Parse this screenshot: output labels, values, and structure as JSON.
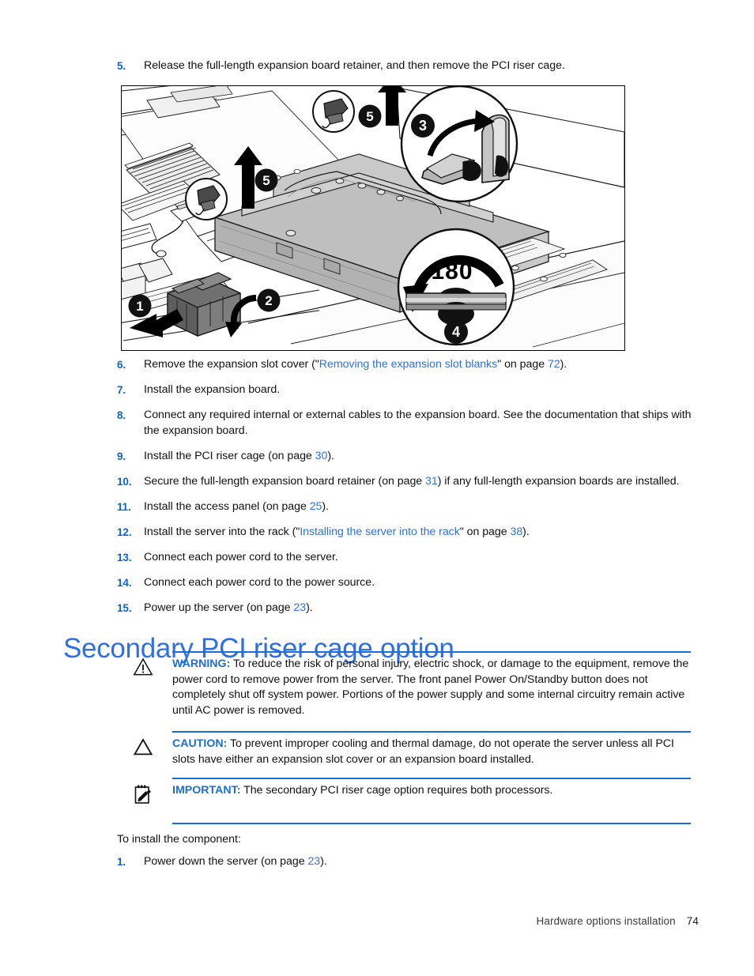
{
  "document": {
    "footer_title": "Hardware options installation",
    "page_number": "74"
  },
  "colors": {
    "link_blue": "#2f6fe4",
    "heading_blue": "#2f6fe4",
    "admonition_blue": "#1a6fd4",
    "number_blue": "#0b63d6"
  },
  "step5": {
    "number": "5.",
    "text": "Release the full-length expansion board retainer, and then remove the PCI riser cage."
  },
  "figure": {
    "caption": "",
    "callouts": [
      {
        "id": "1",
        "meaning": "press-retainer-release"
      },
      {
        "id": "2",
        "meaning": "rotate-retainer-open"
      },
      {
        "id": "3",
        "meaning": "lift-and-rotate-latch"
      },
      {
        "id": "4",
        "meaning": "rotate-180-degrees"
      },
      {
        "id": "5",
        "meaning": "lift-riser-cage-up"
      }
    ],
    "rotation_label": "180",
    "rotation_degree_symbol": "o"
  },
  "steps": [
    {
      "number": "6.",
      "parts": [
        {
          "t": "Remove the expansion slot cover (\"",
          "k": "plain"
        },
        {
          "t": "Removing the expansion slot blanks",
          "k": "link"
        },
        {
          "t": "\" on page ",
          "k": "plain"
        },
        {
          "t": "72",
          "k": "page"
        },
        {
          "t": ").",
          "k": "plain"
        }
      ]
    },
    {
      "number": "7.",
      "parts": [
        {
          "t": "Install the expansion board.",
          "k": "plain"
        }
      ]
    },
    {
      "number": "8.",
      "parts": [
        {
          "t": "Connect any required internal or external cables to the expansion board. See the documentation that ships with the expansion board.",
          "k": "plain"
        }
      ]
    },
    {
      "number": "9.",
      "parts": [
        {
          "t": "Install the PCI riser cage (on page ",
          "k": "plain"
        },
        {
          "t": "30",
          "k": "page"
        },
        {
          "t": ").",
          "k": "plain"
        }
      ]
    },
    {
      "number": "10.",
      "parts": [
        {
          "t": "Secure the full-length expansion board retainer (on page ",
          "k": "plain"
        },
        {
          "t": "31",
          "k": "page"
        },
        {
          "t": ") if any full-length expansion boards are installed.",
          "k": "plain"
        }
      ]
    },
    {
      "number": "11.",
      "parts": [
        {
          "t": "Install the access panel (on page ",
          "k": "plain"
        },
        {
          "t": "25",
          "k": "page"
        },
        {
          "t": ").",
          "k": "plain"
        }
      ]
    },
    {
      "number": "12.",
      "parts": [
        {
          "t": "Install the server into the rack (\"",
          "k": "plain"
        },
        {
          "t": "Installing the server into the rack",
          "k": "link"
        },
        {
          "t": "\" on page ",
          "k": "plain"
        },
        {
          "t": "38",
          "k": "page"
        },
        {
          "t": ").",
          "k": "plain"
        }
      ]
    },
    {
      "number": "13.",
      "parts": [
        {
          "t": "Connect each power cord to the server.",
          "k": "plain"
        }
      ]
    },
    {
      "number": "14.",
      "parts": [
        {
          "t": "Connect each power cord to the power source.",
          "k": "plain"
        }
      ]
    },
    {
      "number": "15.",
      "parts": [
        {
          "t": "Power up the server (on page ",
          "k": "plain"
        },
        {
          "t": "23",
          "k": "page"
        },
        {
          "t": ").",
          "k": "plain"
        }
      ]
    }
  ],
  "heading": {
    "title": "Secondary PCI riser cage option"
  },
  "admonitions": [
    {
      "id": "warning",
      "icon": "warning-triangle-icon",
      "label": "WARNING:",
      "text": "To reduce the risk of personal injury, electric shock, or damage to the equipment, remove the power cord to remove power from the server. The front panel Power On/Standby button does not completely shut off system power. Portions of the power supply and some internal circuitry remain active until AC power is removed."
    },
    {
      "id": "caution",
      "icon": "caution-triangle-icon",
      "label": "CAUTION:",
      "text": "To prevent improper cooling and thermal damage, do not operate the server unless all PCI slots have either an expansion slot cover or an expansion board installed."
    },
    {
      "id": "important",
      "icon": "important-note-icon",
      "label": "IMPORTANT:",
      "text": "The secondary PCI riser cage option requires both processors."
    }
  ],
  "closing": {
    "intro": "To install the component:",
    "steps": [
      {
        "number": "1.",
        "parts": [
          {
            "t": "Power down the server (on page ",
            "k": "plain"
          },
          {
            "t": "23",
            "k": "page"
          },
          {
            "t": ").",
            "k": "plain"
          }
        ]
      }
    ]
  }
}
